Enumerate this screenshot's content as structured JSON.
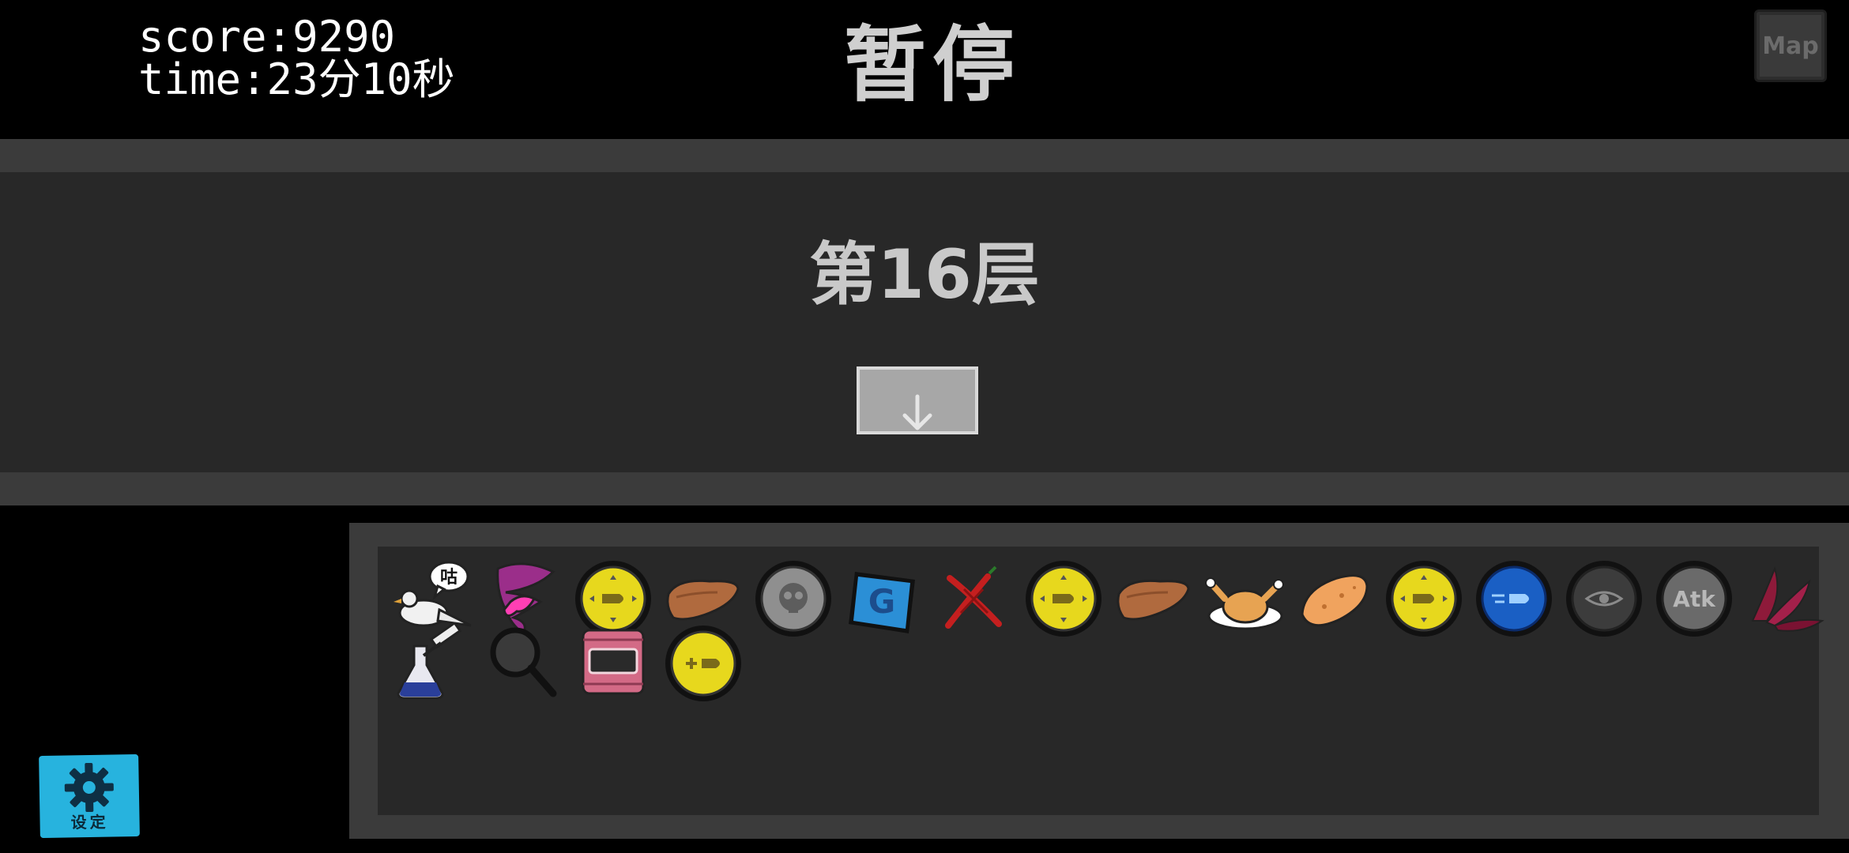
{
  "hud": {
    "score_text": "score:9290",
    "time_text": "time:23分10秒",
    "title": "暂停",
    "map_label": "Map"
  },
  "floor": {
    "label": "第16层",
    "descend_icon": "arrow-down-icon"
  },
  "inventory": {
    "items": [
      {
        "icon": "dove-speech-bubble-icon",
        "speech": "咕"
      },
      {
        "icon": "pink-butterfly-tornado-icon"
      },
      {
        "icon": "yellow-bullet-coin-icon"
      },
      {
        "icon": "brown-liver-icon"
      },
      {
        "icon": "gray-skull-coin-icon"
      },
      {
        "icon": "blue-g-card-icon",
        "letter": "G"
      },
      {
        "icon": "red-crossed-peppers-icon"
      },
      {
        "icon": "yellow-bullet-coin-icon"
      },
      {
        "icon": "brown-liver-icon"
      },
      {
        "icon": "roast-chicken-icon"
      },
      {
        "icon": "potato-icon"
      },
      {
        "icon": "yellow-bullet-coin-icon"
      },
      {
        "icon": "blue-fast-bullet-coin-icon"
      },
      {
        "icon": "dark-eye-coin-icon"
      },
      {
        "icon": "gray-atk-coin-icon",
        "letter": "Atk"
      },
      {
        "icon": "crimson-leaves-icon"
      },
      {
        "icon": "flask-syringe-icon"
      },
      {
        "icon": "magnifying-glass-icon"
      },
      {
        "icon": "pink-treasure-chest-icon"
      },
      {
        "icon": "yellow-plus-bullet-coin-icon"
      }
    ]
  },
  "settings": {
    "label": "设定",
    "icon": "gear-icon"
  },
  "colors": {
    "band": "#3b3b3b",
    "panel": "#282828",
    "settings_blue": "#27b3de",
    "coin_yellow": "#e7d81d"
  }
}
